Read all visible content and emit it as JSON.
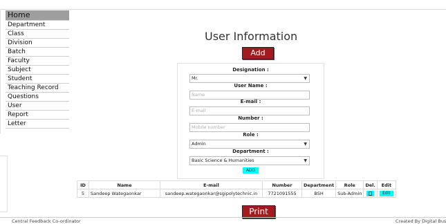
{
  "sidebar": {
    "items": [
      {
        "label": "Home",
        "active": true
      },
      {
        "label": "Department"
      },
      {
        "label": "Class"
      },
      {
        "label": "Division"
      },
      {
        "label": "Batch"
      },
      {
        "label": "Faculty"
      },
      {
        "label": "Subject"
      },
      {
        "label": "Student"
      },
      {
        "label": "Teaching Record"
      },
      {
        "label": "Questions"
      },
      {
        "label": "User"
      },
      {
        "label": "Report"
      },
      {
        "label": "Letter"
      }
    ]
  },
  "main": {
    "title": "User Information",
    "add_label": "Add",
    "print_label": "Print"
  },
  "form": {
    "designation_label": "Designation :",
    "designation_value": "Mr.",
    "username_label": "User Name :",
    "username_placeholder": "Name",
    "email_label": "E-mail :",
    "email_placeholder": "E-mail",
    "number_label": "Number :",
    "number_placeholder": "Mobile number",
    "role_label": "Role :",
    "role_value": "Admin",
    "department_label": "Department :",
    "department_value": "Basic Science & Humanities",
    "submit_label": "ADD"
  },
  "table": {
    "headers": [
      "ID",
      "Name",
      "E-mail",
      "Number",
      "Department",
      "Role",
      "Del.",
      "Edit"
    ],
    "rows": [
      {
        "id": "5",
        "name": "Sandeep Wategaonkar",
        "email": "sandeep.wategaonkar@sgipolytechnic.in",
        "number": "7721091555",
        "department": "BSH",
        "role": "Sub-Admin",
        "edit_label": "Edit"
      }
    ]
  },
  "footer": {
    "left": "Central Feedback Co-ordinator",
    "right": "Created By Digital Bus"
  },
  "colors": {
    "accent_red": "#a31b1f",
    "cyan": "#00ffff",
    "active_nav": "#9e9e9e"
  }
}
